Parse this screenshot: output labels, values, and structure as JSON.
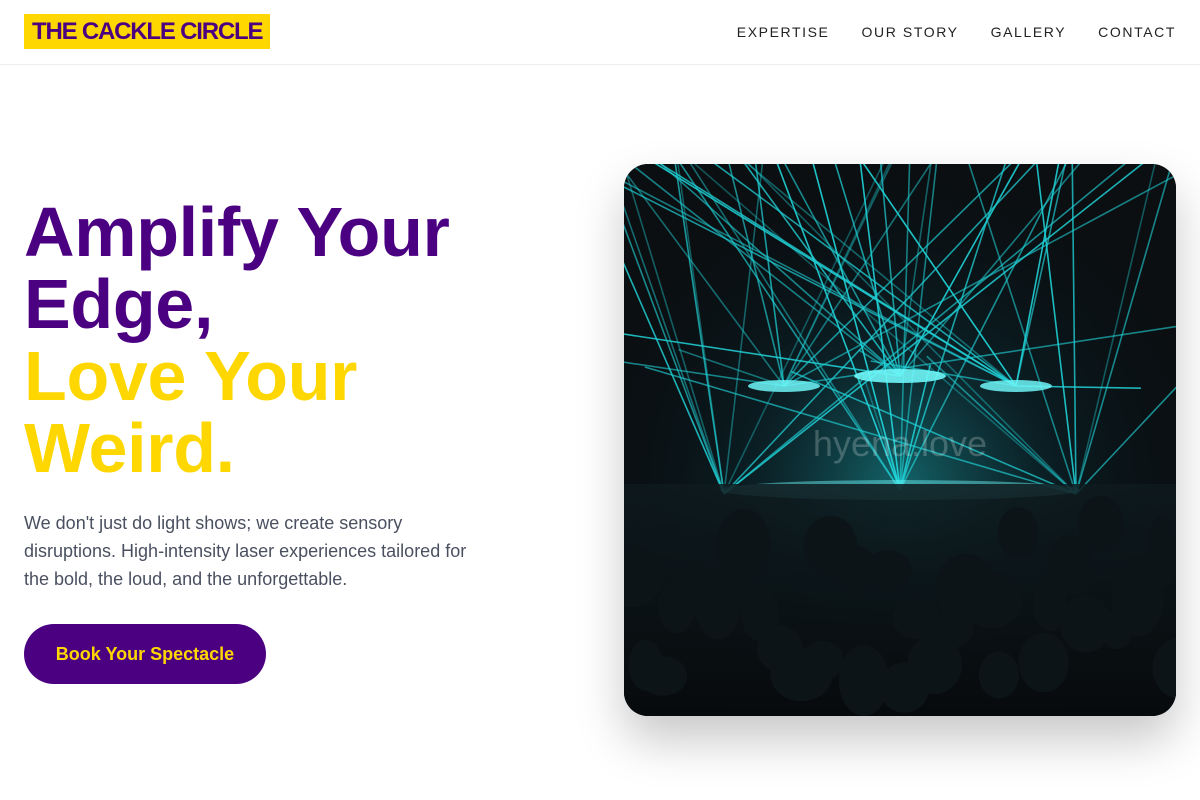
{
  "nav": {
    "logo": "THE CACKLE CIRCLE",
    "links": [
      "EXPERTISE",
      "OUR STORY",
      "GALLERY",
      "CONTACT"
    ]
  },
  "hero": {
    "title_line1": "Amplify Your",
    "title_line2": "Edge,",
    "title_line3": "Love Your",
    "title_line4": "Weird.",
    "description": "We don't just do light shows; we create sensory disruptions. High-intensity laser experiences tailored for the bold, the loud, and the unforgettable.",
    "cta_label": "Book Your Spectacle",
    "image_watermark": "hyena.love"
  },
  "colors": {
    "brand_purple": "#4b0082",
    "brand_yellow": "#ffd700",
    "laser_cyan": "#22e3e8"
  }
}
